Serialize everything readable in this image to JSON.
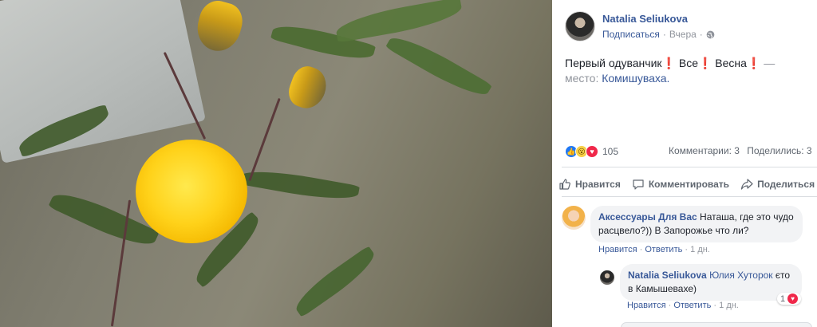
{
  "post": {
    "author": "Natalia Seliukova",
    "follow": "Подписаться",
    "separator": "·",
    "time": "Вчера",
    "separator2": "·",
    "privacy_icon": "globe-icon",
    "text": "Первый одуванчик❗ Все❗ Весна❗",
    "location_prefix": "— место:",
    "location": "Комишуваха."
  },
  "stats": {
    "reactions": [
      "like",
      "wow",
      "love"
    ],
    "reaction_count": "105",
    "comments": "Комментарии: 3",
    "shares": "Поделились: 3"
  },
  "actions": {
    "like": "Нравится",
    "comment": "Комментировать",
    "share": "Поделиться"
  },
  "comments": [
    {
      "author": "Аксессуары Для Вас",
      "text": "Наташа, где это чудо расцвело?)) В Запорожье что ли?",
      "like": "Нравится",
      "reply": "Ответить",
      "time": "1 дн."
    },
    {
      "author": "Natalia Seliukova",
      "mention": "Юлия Хуторок",
      "text": "єто в Камышевахе)",
      "like": "Нравится",
      "reply": "Ответить",
      "time": "1 дн.",
      "reactions": "1"
    }
  ],
  "colors": {
    "link": "#385898",
    "muted": "#90949c",
    "bubble": "#f2f3f5",
    "like_blue": "#2078f4",
    "love_red": "#f0284a"
  }
}
